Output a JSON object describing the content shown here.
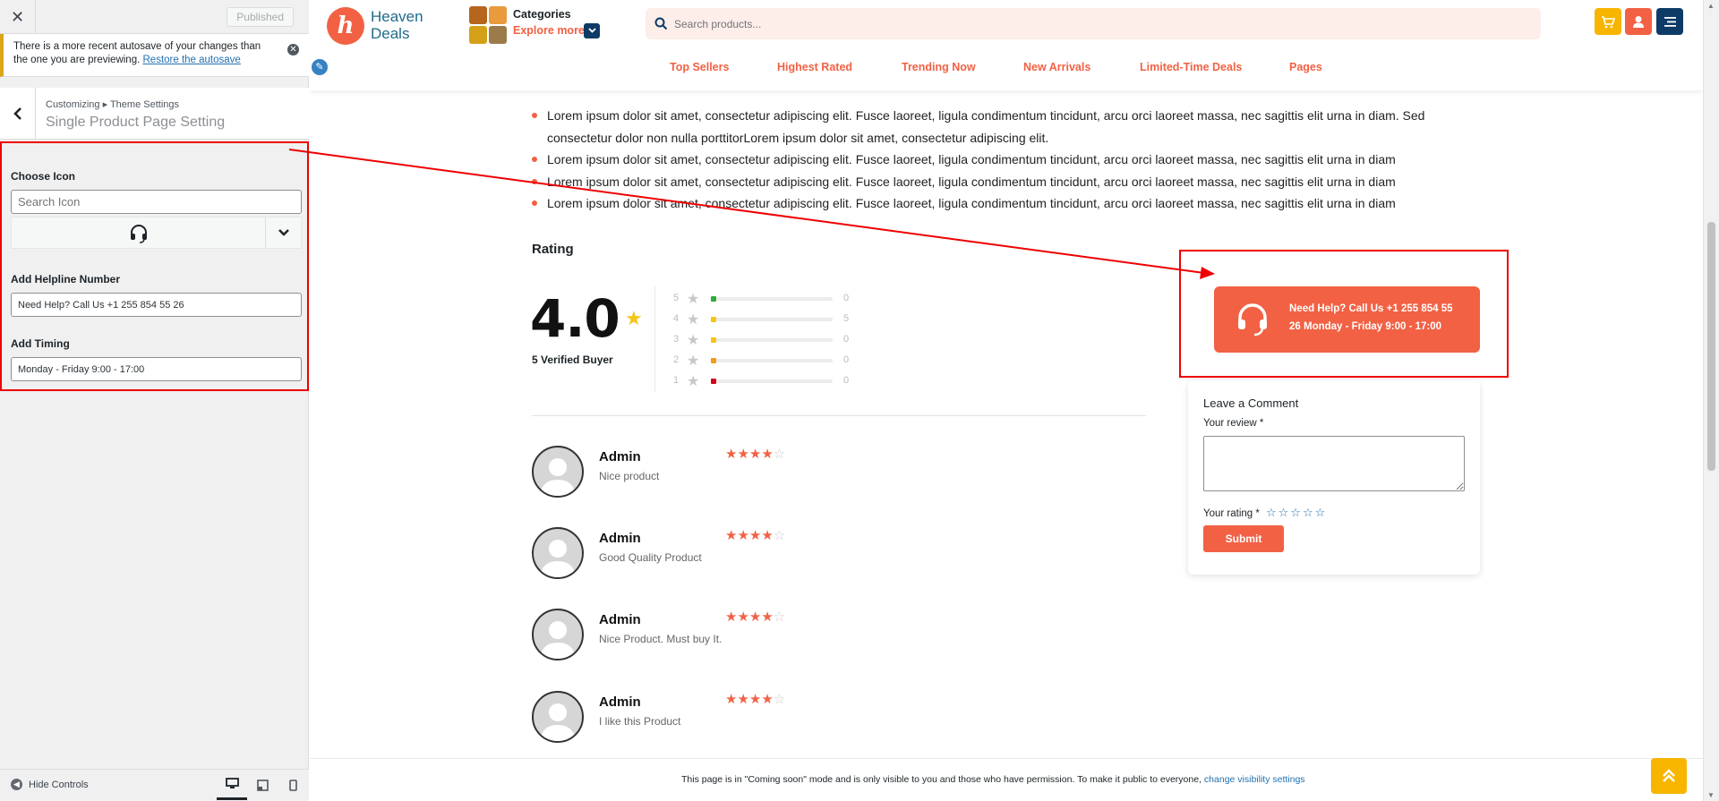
{
  "customizer": {
    "published_label": "Published",
    "notice_text": "There is a more recent autosave of your changes than the one you are previewing.",
    "notice_link": "Restore the autosave",
    "breadcrumb": "Customizing ▸ Theme Settings",
    "section_title": "Single Product Page Setting",
    "choose_icon_label": "Choose Icon",
    "search_icon_placeholder": "Search Icon",
    "helpline_label": "Add Helpline Number",
    "helpline_value": "Need Help? Call Us +1 255 854 55 26",
    "timing_label": "Add Timing",
    "timing_value": "Monday - Friday 9:00 - 17:00",
    "hide_controls": "Hide Controls"
  },
  "header": {
    "logo_line1": "Heaven",
    "logo_line2": "Deals",
    "categories_title": "Categories",
    "explore_more": "Explore more",
    "search_placeholder": "Search products...",
    "nav": [
      "Top Sellers",
      "Highest Rated",
      "Trending Now",
      "New Arrivals",
      "Limited-Time Deals",
      "Pages"
    ],
    "colors": {
      "accent": "#f26144",
      "brand": "#1f6a8a",
      "cart": "#f7b500",
      "navy": "#0d3b66"
    }
  },
  "content": {
    "bullets": [
      "Lorem ipsum dolor sit amet, consectetur adipiscing elit. Fusce laoreet, ligula condimentum tincidunt, arcu orci laoreet massa, nec sagittis elit urna in diam. Sed consectetur dolor non nulla porttitorLorem ipsum dolor sit amet, consectetur adipiscing elit.",
      "Lorem ipsum dolor sit amet, consectetur adipiscing elit. Fusce laoreet, ligula condimentum tincidunt, arcu orci laoreet massa, nec sagittis elit urna in diam",
      "Lorem ipsum dolor sit amet, consectetur adipiscing elit. Fusce laoreet, ligula condimentum tincidunt, arcu orci laoreet massa, nec sagittis elit urna in diam",
      "Lorem ipsum dolor sit amet, consectetur adipiscing elit. Fusce laoreet, ligula condimentum tincidunt, arcu orci laoreet massa, nec sagittis elit urna in diam"
    ],
    "rating_heading": "Rating",
    "rating_value": "4.0",
    "verified": "5 Verified Buyer",
    "distribution": [
      {
        "stars": "5",
        "count": "0",
        "color": "#2eaa3a"
      },
      {
        "stars": "4",
        "count": "5",
        "color": "#f5c518"
      },
      {
        "stars": "3",
        "count": "0",
        "color": "#f5c518"
      },
      {
        "stars": "2",
        "count": "0",
        "color": "#f59a18"
      },
      {
        "stars": "1",
        "count": "0",
        "color": "#d0021b"
      }
    ],
    "reviews": [
      {
        "name": "Admin",
        "text": "Nice product",
        "rating": 4
      },
      {
        "name": "Admin",
        "text": "Good Quality Product",
        "rating": 4
      },
      {
        "name": "Admin",
        "text": "Nice Product. Must buy It.",
        "rating": 4
      },
      {
        "name": "Admin",
        "text": "I like this Product",
        "rating": 4
      }
    ],
    "help": {
      "line1": "Need Help? Call Us +1 255 854 55",
      "line2": "26 Monday - Friday 9:00 - 17:00"
    },
    "comment": {
      "title": "Leave a Comment",
      "review_label": "Your review *",
      "rating_label": "Your rating *",
      "rating_stars": "☆☆☆☆☆",
      "submit": "Submit"
    },
    "coming_soon": "This page is in \"Coming soon\" mode and is only visible to you and those who have permission. To make it public to everyone,",
    "coming_soon_link": "change visibility settings"
  }
}
